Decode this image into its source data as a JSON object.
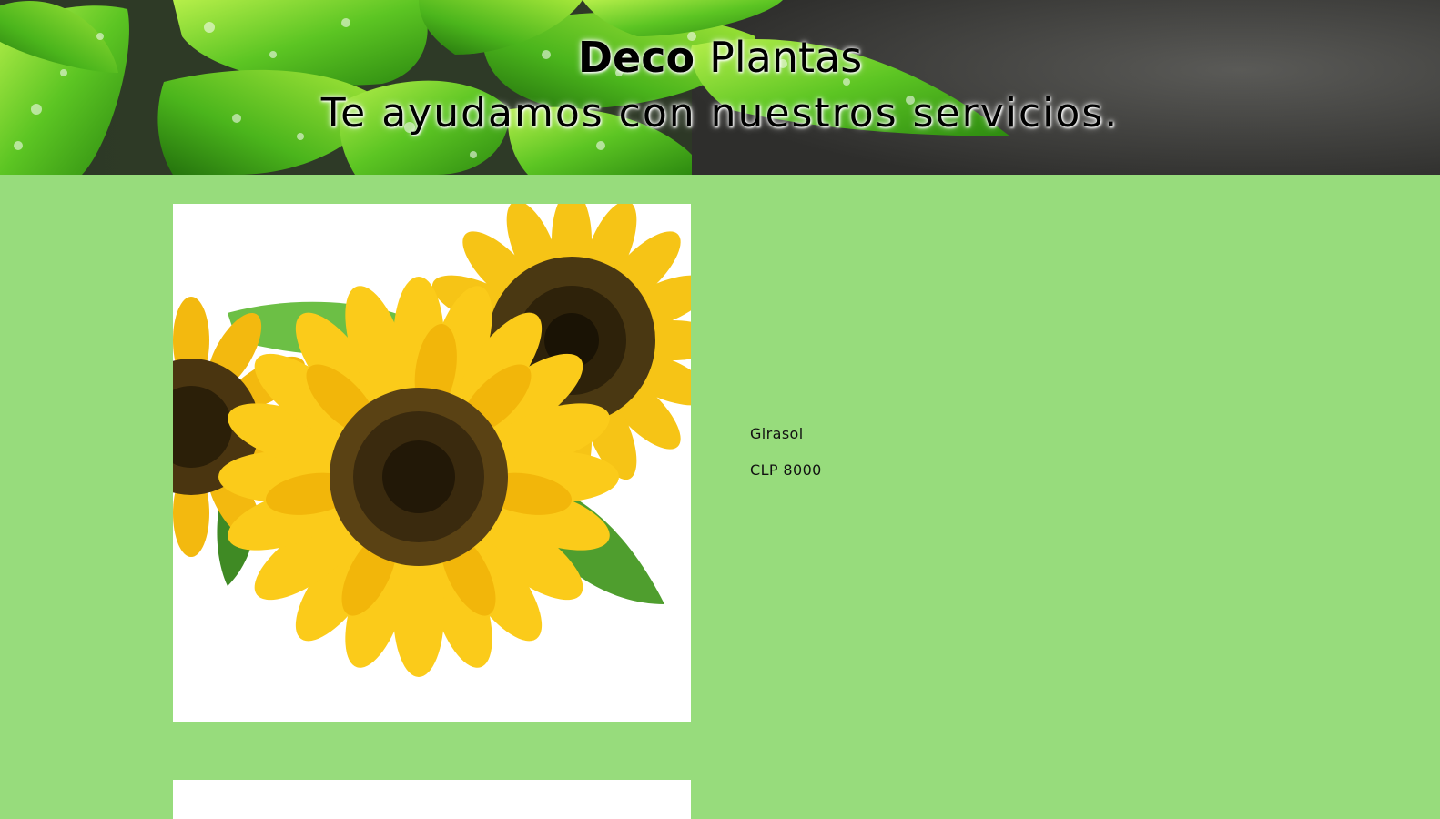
{
  "header": {
    "brand_strong": "Deco",
    "brand_light": "Plantas",
    "tagline": "Te ayudamos con nuestros servicios."
  },
  "products": [
    {
      "name": "Girasol",
      "price": "CLP 8000",
      "image_icon": "sunflower-image"
    }
  ],
  "colors": {
    "page_background": "#97dc7c",
    "card_background": "#ffffff",
    "text": "#111111",
    "petal": "#f7c81b",
    "seed_center": "#3a2a0e",
    "leaf": "#55b82e"
  }
}
